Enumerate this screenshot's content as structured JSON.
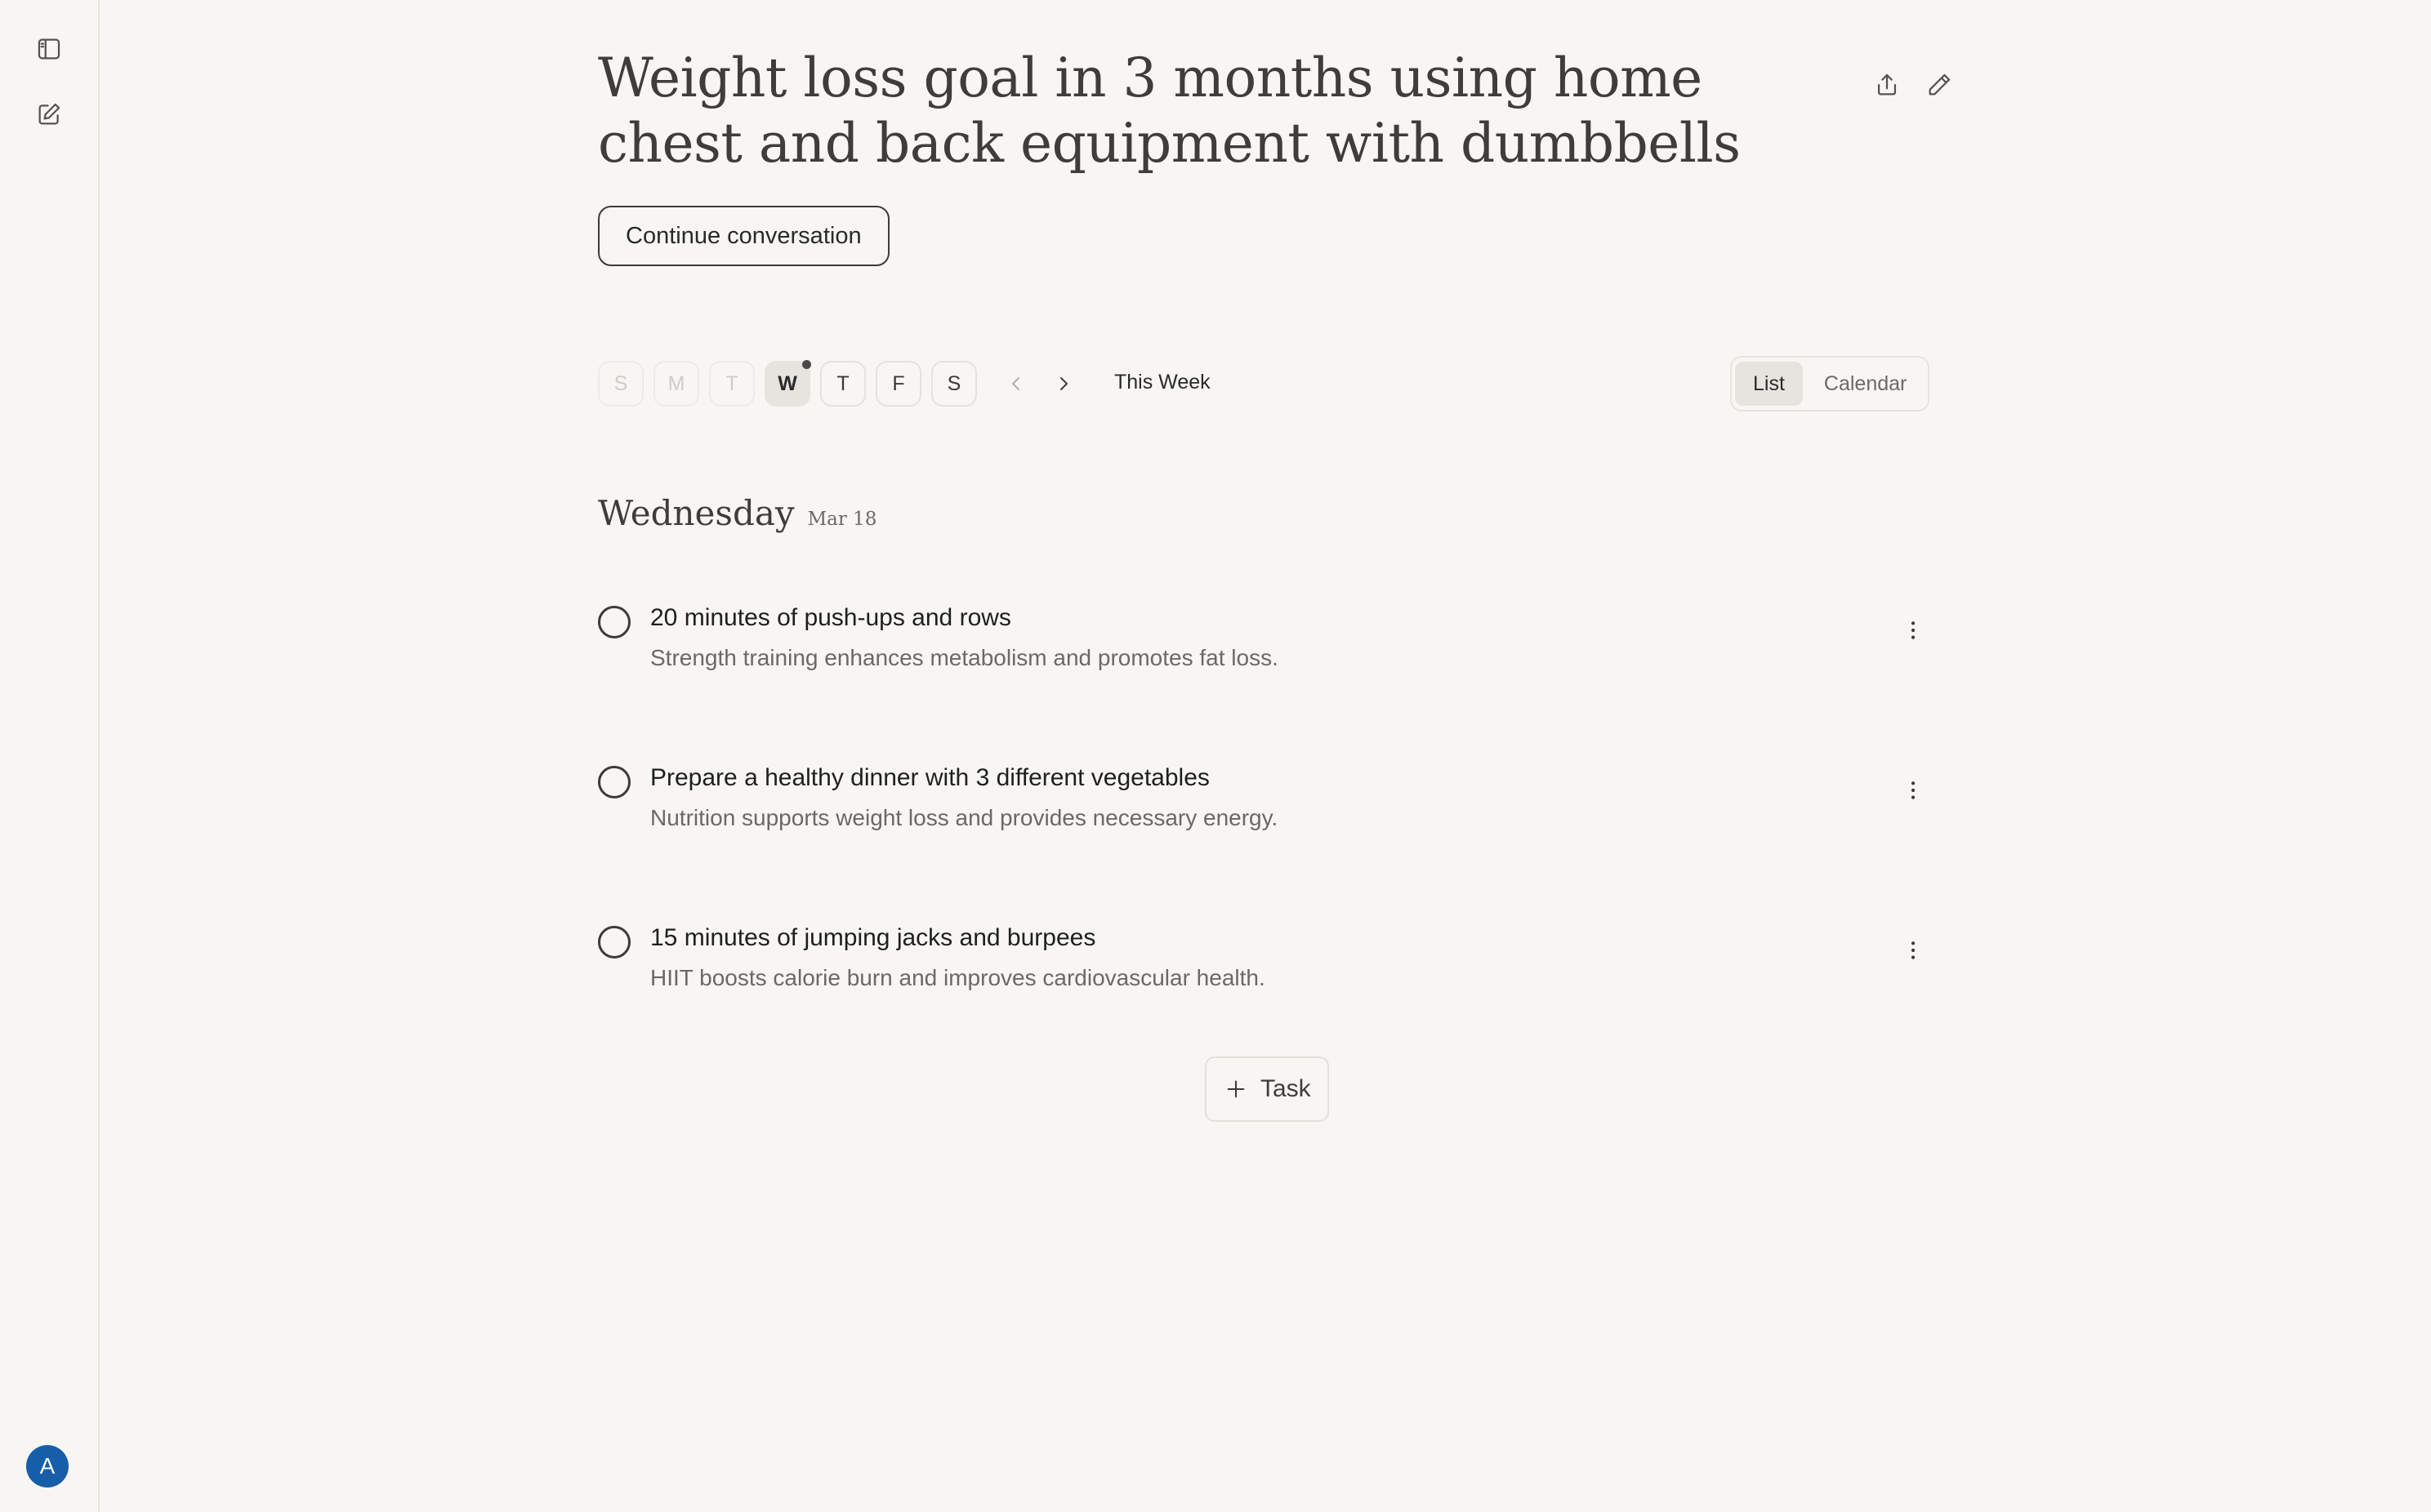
{
  "sidebar": {
    "toggle_icon": "sidebar-panel-icon",
    "new_icon": "compose-icon",
    "avatar_initial": "A",
    "avatar_color": "#175ea8"
  },
  "header": {
    "title": "Weight loss goal in 3 months using home chest and back equipment with dumbbells",
    "share_icon": "share-icon",
    "edit_icon": "pencil-icon",
    "continue_label": "Continue conversation"
  },
  "week": {
    "days": [
      "S",
      "M",
      "T",
      "W",
      "T",
      "F",
      "S"
    ],
    "active_index": 3,
    "label": "This Week",
    "view_options": [
      "List",
      "Calendar"
    ],
    "selected_view": "List"
  },
  "day": {
    "name": "Wednesday",
    "date": "Mar 18"
  },
  "tasks": [
    {
      "title": "20 minutes of push-ups and rows",
      "description": "Strength training enhances metabolism and promotes fat loss.",
      "completed": false
    },
    {
      "title": "Prepare a healthy dinner with 3 different vegetables",
      "description": "Nutrition supports weight loss and provides necessary energy.",
      "completed": false
    },
    {
      "title": "15 minutes of jumping jacks and burpees",
      "description": "HIIT boosts calorie burn and improves cardiovascular health.",
      "completed": false
    }
  ],
  "add_task_label": "Task",
  "colors": {
    "background": "#f7f6f3",
    "text": "#2a2a2a",
    "muted": "#6b6965",
    "accent_avatar": "#175ea8"
  }
}
